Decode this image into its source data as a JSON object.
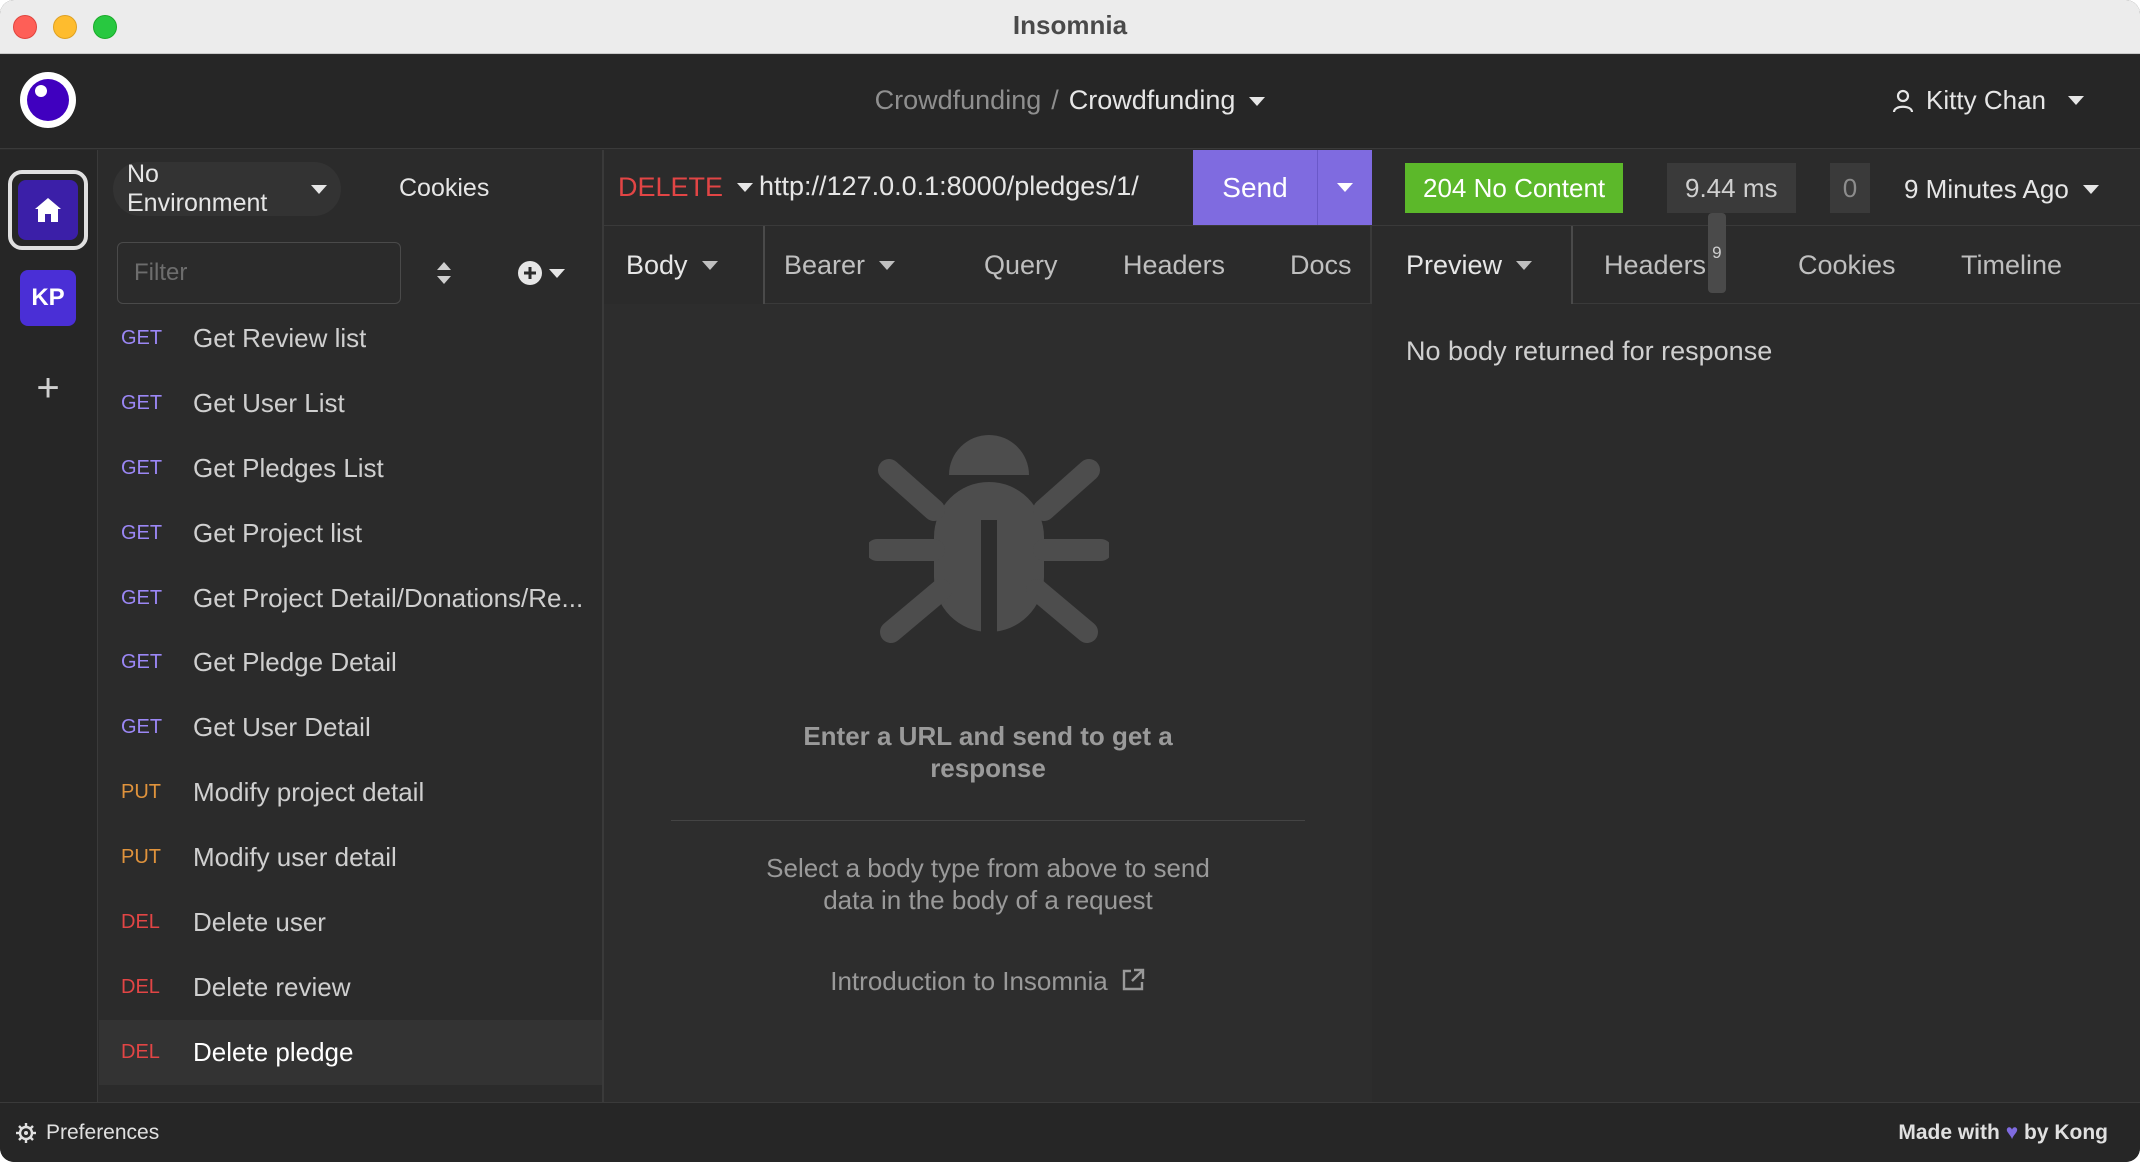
{
  "window": {
    "title": "Insomnia"
  },
  "header": {
    "breadcrumb_parent": "Crowdfunding",
    "breadcrumb_sep": "/",
    "breadcrumb_current": "Crowdfunding",
    "user_name": "Kitty Chan"
  },
  "rail": {
    "project_initials": "KP",
    "add_label": "+"
  },
  "sidebar": {
    "environment_label": "No Environment",
    "cookies_label": "Cookies",
    "filter_placeholder": "Filter",
    "requests": [
      {
        "method": "GET",
        "label": "Get Review list",
        "color": "#9b87f5"
      },
      {
        "method": "GET",
        "label": "Get User List",
        "color": "#9b87f5"
      },
      {
        "method": "GET",
        "label": "Get Pledges List",
        "color": "#9b87f5"
      },
      {
        "method": "GET",
        "label": "Get Project list",
        "color": "#9b87f5"
      },
      {
        "method": "GET",
        "label": "Get Project Detail/Donations/Re...",
        "color": "#9b87f5"
      },
      {
        "method": "GET",
        "label": "Get Pledge Detail",
        "color": "#9b87f5"
      },
      {
        "method": "GET",
        "label": "Get User Detail",
        "color": "#9b87f5"
      },
      {
        "method": "PUT",
        "label": "Modify project detail",
        "color": "#e0933c"
      },
      {
        "method": "PUT",
        "label": "Modify user detail",
        "color": "#e0933c"
      },
      {
        "method": "DEL",
        "label": "Delete user",
        "color": "#e24545"
      },
      {
        "method": "DEL",
        "label": "Delete review",
        "color": "#e24545"
      },
      {
        "method": "DEL",
        "label": "Delete pledge",
        "color": "#e24545",
        "active": true
      }
    ]
  },
  "request": {
    "method": "DELETE",
    "url": "http://127.0.0.1:8000/pledges/1/",
    "send_label": "Send",
    "tabs": [
      "Body",
      "Bearer",
      "Query",
      "Headers",
      "Docs"
    ],
    "empty_title": "Enter a URL and send to get a response",
    "empty_desc": "Select a body type from above to send data in the body of a request",
    "intro_link": "Introduction to Insomnia"
  },
  "response": {
    "status": "204 No Content",
    "time": "9.44 ms",
    "size": "0",
    "ago": "9 Minutes Ago",
    "tabs": [
      "Preview",
      "Headers",
      "Cookies",
      "Timeline"
    ],
    "headers_count": "9",
    "body_message": "No body returned for response"
  },
  "footer": {
    "preferences_label": "Preferences",
    "made_with_prefix": "Made with",
    "made_with_suffix": "by Kong"
  },
  "colors": {
    "accent": "#7f6be0",
    "status_success": "#5cb82a",
    "delete_method": "#e24545",
    "put_method": "#e0933c",
    "get_method": "#9b87f5"
  }
}
